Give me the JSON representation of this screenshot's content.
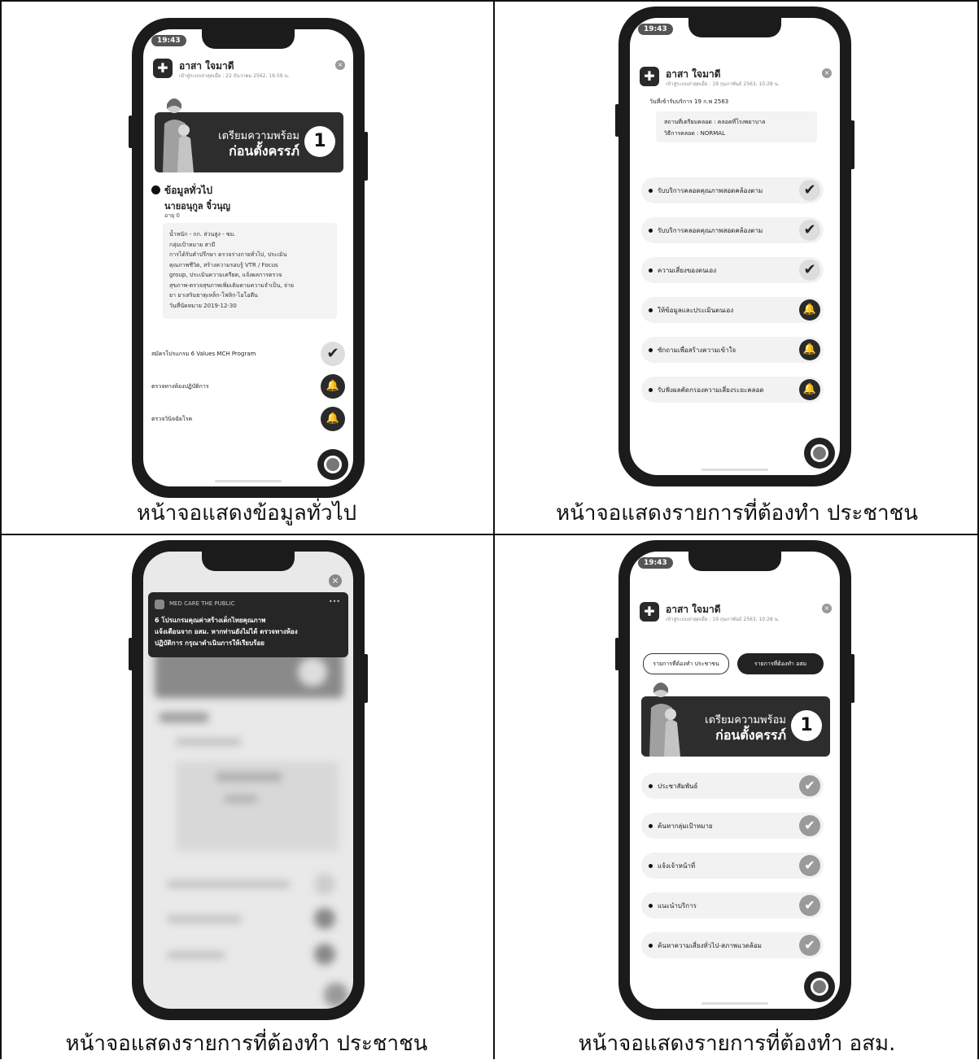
{
  "captions": {
    "top_left": "หน้าจอแสดงข้อมูลทั่วไป",
    "top_right": "หน้าจอแสดงรายการที่ต้องทำ ประชาชน",
    "bottom_left": "หน้าจอแสดงรายการที่ต้องทำ ประชาชน",
    "bottom_right": "หน้าจอแสดงรายการที่ต้องทำ อสม."
  },
  "status_time": "19:43",
  "user_name": "อาสา ใจมาดี",
  "screen1": {
    "last_login": "เข้าสู่ระบบล่าสุดเมื่อ : 22 ธันวาคม 2562, 16:59 น.",
    "banner_line1": "เตรียมความพร้อม",
    "banner_line2": "ก่อนตั้งครรภ์",
    "banner_number": "1",
    "section_title": "ข้อมูลทั่วไป",
    "person_name": "นายอนุกูล จิ๋วนุญ",
    "age": "อายุ 0",
    "detail_lines": [
      "น้ำหนัก - กก. ส่วนสูง - ซม.",
      "กลุ่มเป้าหมาย สามี",
      "การได้รับคำปรึกษา ตรวจร่างกายทั่วไป, ประเมิน",
      "คุณภาพชีวิต, สร้างความรอบรู้ VTR / Focus",
      "group, ประเมินความเครียด, แจ้งผลการตรวจ",
      "สุขภาพ-ตรวจสุขภาพเพิ่มเติมตามความจำเป็น, จ่าย",
      "ยา ยาเสริมธาตุเหล็ก-โฟลิก-ไอโอดีน",
      "วันที่นัดหมาย 2019-12-30"
    ],
    "items": [
      {
        "label": "สมัครโปรแกรม 6 Values MCH Program",
        "status": "done"
      },
      {
        "label": "ตรวจทางห้องปฏิบัติการ",
        "status": "pending"
      },
      {
        "label": "ตรวจวินิจฉัยโรค",
        "status": "pending"
      }
    ]
  },
  "screen2": {
    "last_login": "เข้าสู่ระบบล่าสุดเมื่อ : 19 กุมภาพันธ์ 2563, 10:28 น.",
    "service_date": "วันที่เข้ารับบริการ 19 ก.พ 2563",
    "info_line1": "สถานที่เตรียมคลอด : คลอดที่โรงพยาบาล",
    "info_line2": "วิธีการคลอด : NORMAL",
    "tasks": [
      {
        "label": "รับบริการคลอดคุณภาพสอดคล้องตาม",
        "status": "done"
      },
      {
        "label": "รับบริการคลอดคุณภาพสอดคล้องตาม",
        "status": "done"
      },
      {
        "label": "ความเสี่ยงของตนเอง",
        "status": "done"
      },
      {
        "label": "ให้ข้อมูลและประเมินตนเอง",
        "status": "pending"
      },
      {
        "label": "ซักถามเพื่อสร้างความเข้าใจ",
        "status": "pending"
      },
      {
        "label": "รับฟังผลคัดกรองความเสี่ยงระยะคลอด",
        "status": "pending"
      }
    ]
  },
  "screen3": {
    "notif_app": "MED CARE THE PUBLIC",
    "notif_more": "•••",
    "notif_line1": "6 โปรแกรมคุณค่าสร้างเด็กไทยคุณภาพ",
    "notif_line2": "แจ้งเตือนจาก อสม. หากท่านยังไม่ได้ ตรวจทางห้อง",
    "notif_line3": "ปฏิบัติการ กรุณาดำเนินการให้เรียบร้อย"
  },
  "screen4": {
    "last_login": "เข้าสู่ระบบล่าสุดเมื่อ : 19 กุมภาพันธ์ 2563, 10:28 น.",
    "tab_public": "รายการที่ต้องทำ ประชาชน",
    "tab_osm": "รายการที่ต้องทำ อสม",
    "banner_line1": "เตรียมความพร้อม",
    "banner_line2": "ก่อนตั้งครรภ์",
    "banner_number": "1",
    "tasks": [
      {
        "label": "ประชาสัมพันธ์",
        "status": "done"
      },
      {
        "label": "ค้นหากลุ่มเป้าหมาย",
        "status": "done"
      },
      {
        "label": "แจ้งเจ้าหน้าที่",
        "status": "done"
      },
      {
        "label": "แนะนำบริการ",
        "status": "done"
      },
      {
        "label": "ค้นหาความเสี่ยงทั่วไป-สภาพแวดล้อม",
        "status": "done"
      }
    ]
  },
  "icons": {
    "check": "✔",
    "bell": "🔔",
    "close": "×"
  }
}
